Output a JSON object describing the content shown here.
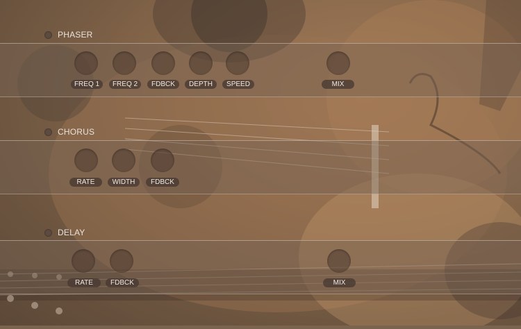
{
  "phaser": {
    "title": "PHASER",
    "knobs": [
      "FREQ 1",
      "FREQ 2",
      "FDBCK",
      "DEPTH",
      "SPEED",
      "MIX"
    ]
  },
  "chorus": {
    "title": "CHORUS",
    "knobs": [
      "RATE",
      "WIDTH",
      "FDBCK"
    ]
  },
  "delay": {
    "title": "DELAY",
    "knobs": [
      "RATE",
      "FDBCK",
      "MIX"
    ]
  }
}
